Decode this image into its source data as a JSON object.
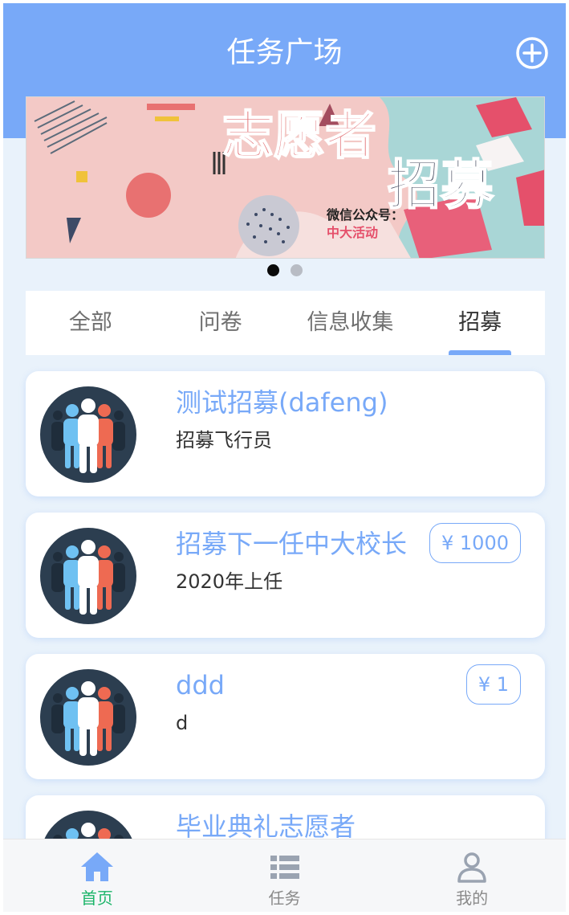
{
  "header": {
    "title": "任务广场",
    "add_icon": "plus-circle-icon"
  },
  "banner": {
    "headline_1": "志愿者",
    "headline_2": "招募",
    "wechat_label": "微信公众号：",
    "wechat_name": "中大活动",
    "slide_count": 2,
    "active_slide": 1
  },
  "tabs": [
    {
      "label": "全部",
      "active": false
    },
    {
      "label": "问卷",
      "active": false
    },
    {
      "label": "信息收集",
      "active": false
    },
    {
      "label": "招募",
      "active": true
    }
  ],
  "tasks": [
    {
      "title": "测试招募(dafeng)",
      "subtitle": "招募飞行员",
      "price": ""
    },
    {
      "title": "招募下一任中大校长",
      "subtitle": "2020年上任",
      "price": "¥ 1000"
    },
    {
      "title": "ddd",
      "subtitle": "d",
      "price": "¥ 1"
    },
    {
      "title": "毕业典礼志愿者",
      "subtitle": "",
      "price": ""
    }
  ],
  "tabbar": [
    {
      "label": "首页",
      "icon": "home-icon",
      "active": true
    },
    {
      "label": "任务",
      "icon": "list-icon",
      "active": false
    },
    {
      "label": "我的",
      "icon": "user-icon",
      "active": false
    }
  ],
  "colors": {
    "primary": "#78a9f8",
    "background": "#e9f2fb",
    "active_tabbar": "#1db56a",
    "avatar_bg": "#2c3e50"
  }
}
